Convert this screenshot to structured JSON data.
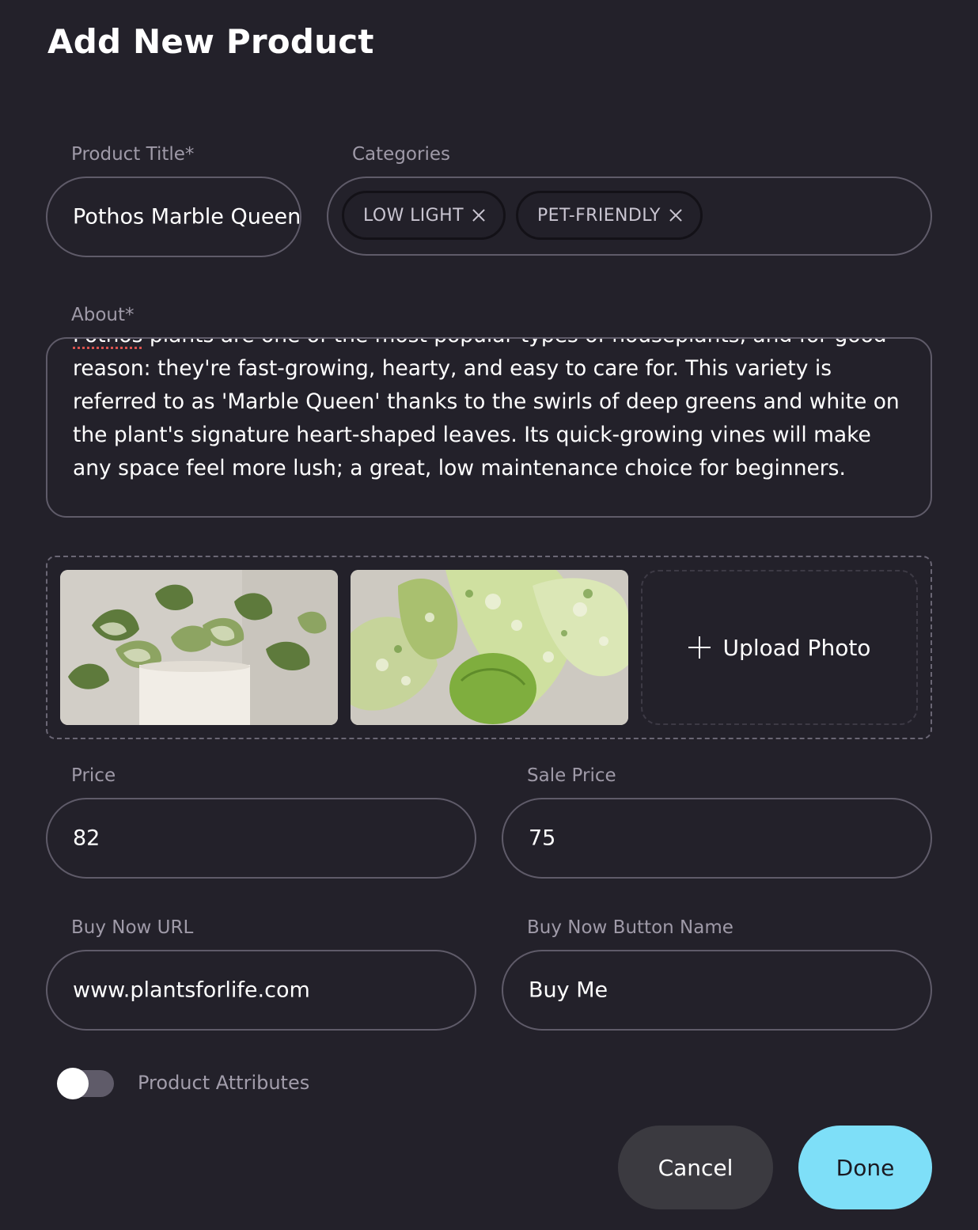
{
  "page": {
    "title": "Add New Product"
  },
  "product_title": {
    "label": "Product Title*",
    "value": "Pothos Marble Queen"
  },
  "categories": {
    "label": "Categories",
    "chips": [
      {
        "label": "LOW LIGHT"
      },
      {
        "label": "PET-FRIENDLY"
      }
    ]
  },
  "about": {
    "label": "About*",
    "first_word": "Pothos",
    "text_rest": " plants are one of the most popular types of houseplants, and for good reason: they're fast-growing, hearty, and easy to care for. This variety is referred to as 'Marble Queen' thanks to the swirls of deep greens and white on the plant's signature heart-shaped leaves. Its quick-growing vines will make any space feel more lush; a great, low maintenance choice for beginners."
  },
  "photos": {
    "items": [
      {
        "alt": "pothos-plant-in-white-pot"
      },
      {
        "alt": "pothos-leaves-closeup"
      }
    ],
    "upload_label": "Upload Photo"
  },
  "price": {
    "label": "Price",
    "value": "82"
  },
  "sale_price": {
    "label": "Sale Price",
    "value": "75"
  },
  "buy_now_url": {
    "label": "Buy Now URL",
    "value": "www.plantsforlife.com"
  },
  "buy_now_button_name": {
    "label": "Buy Now Button Name",
    "value": "Buy Me"
  },
  "attributes_toggle": {
    "label": "Product Attributes",
    "on": false
  },
  "actions": {
    "cancel": "Cancel",
    "done": "Done"
  },
  "colors": {
    "background": "#23212a",
    "accent": "#7edff8",
    "border": "#5f5b69"
  }
}
